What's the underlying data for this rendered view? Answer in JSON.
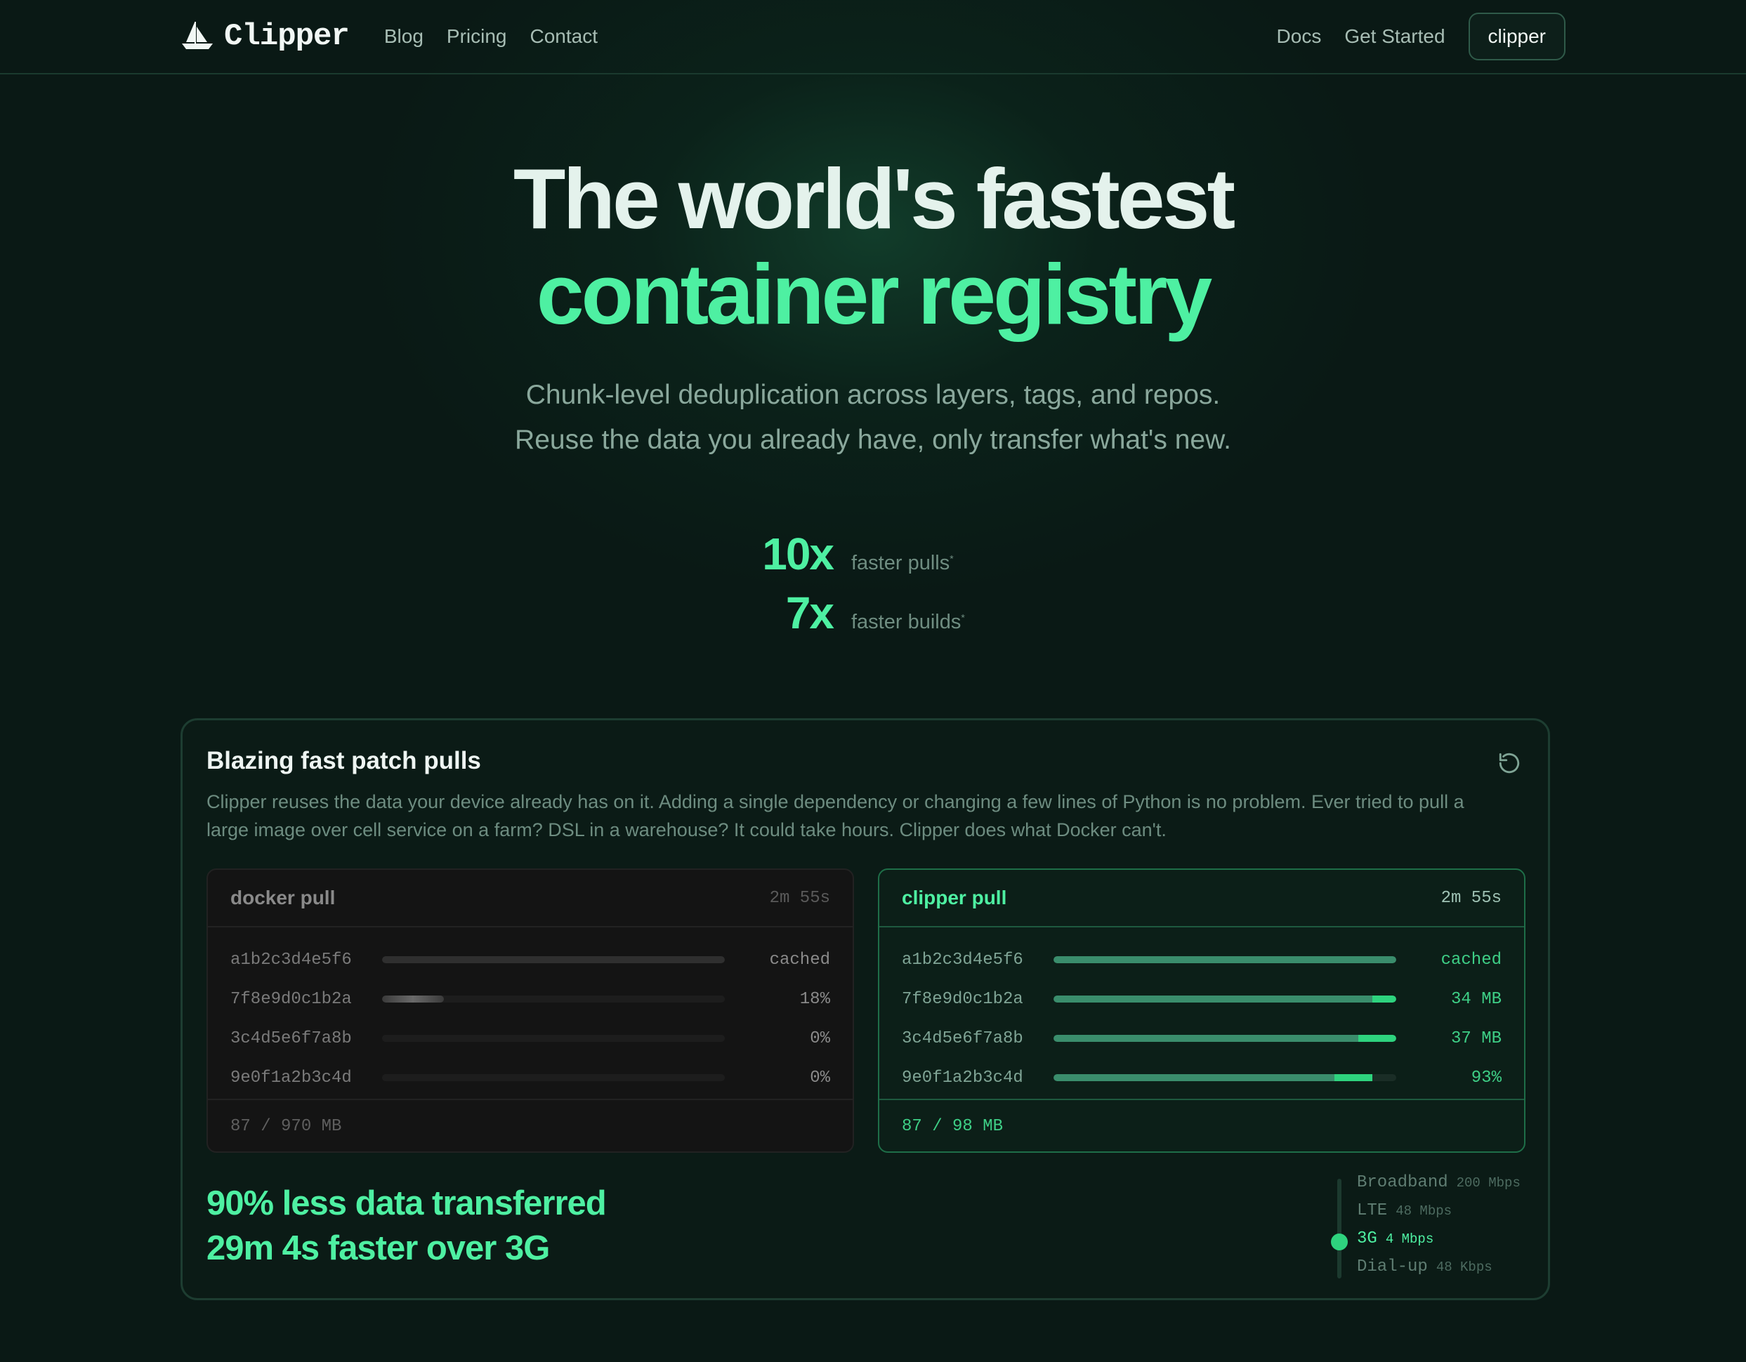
{
  "nav": {
    "brand": "Clipper",
    "links": [
      "Blog",
      "Pricing",
      "Contact"
    ],
    "right_links": [
      "Docs",
      "Get Started"
    ],
    "button_label": "clipper"
  },
  "hero": {
    "title_line1": "The world's fastest",
    "title_line2": "container registry",
    "subtitle_line1": "Chunk-level deduplication across layers, tags, and repos.",
    "subtitle_line2": "Reuse the data you already have, only transfer what's new."
  },
  "stats": [
    {
      "value": "10x",
      "label": "faster pulls",
      "mark": "*"
    },
    {
      "value": "7x",
      "label": "faster builds",
      "mark": "*"
    }
  ],
  "card": {
    "title": "Blazing fast patch pulls",
    "description": "Clipper reuses the data your device already has on it. Adding a single dependency or changing a few lines of Python is no problem. Ever tried to pull a large image over cell service on a farm? DSL in a warehouse? It could take hours. Clipper does what Docker can't.",
    "refresh_icon": "refresh-icon",
    "docker": {
      "name": "docker pull",
      "time": "2m 55s",
      "rows": [
        {
          "hash": "a1b2c3d4e5f6",
          "value": "cached",
          "progress": 1.0
        },
        {
          "hash": "7f8e9d0c1b2a",
          "value": "18%",
          "progress": 0.18
        },
        {
          "hash": "3c4d5e6f7a8b",
          "value": "0%",
          "progress": 0
        },
        {
          "hash": "9e0f1a2b3c4d",
          "value": "0%",
          "progress": 0
        }
      ],
      "footer": "87 / 970 MB"
    },
    "clipper": {
      "name": "clipper pull",
      "time": "2m 55s",
      "rows": [
        {
          "hash": "a1b2c3d4e5f6",
          "value": "cached",
          "reused": 1.0,
          "new": 0
        },
        {
          "hash": "7f8e9d0c1b2a",
          "value": "34 MB",
          "reused": 0.93,
          "new": 0.07
        },
        {
          "hash": "3c4d5e6f7a8b",
          "value": "37 MB",
          "reused": 0.89,
          "new": 0.11
        },
        {
          "hash": "9e0f1a2b3c4d",
          "value": "93%",
          "reused": 0.82,
          "new": 0.11
        }
      ],
      "footer": "87 / 98 MB"
    },
    "result_line1": "90% less data transferred",
    "result_line2": "29m 4s faster over 3G",
    "speeds": [
      {
        "name": "Broadband",
        "rate": "200 Mbps"
      },
      {
        "name": "LTE",
        "rate": "48 Mbps"
      },
      {
        "name": "3G",
        "rate": "4 Mbps",
        "active": true
      },
      {
        "name": "Dial-up",
        "rate": "48 Kbps"
      }
    ]
  },
  "colors": {
    "accent": "#4ef0a2",
    "background": "#0a1915",
    "progress_new": "#2ed37e",
    "progress_reused": "#3a8d6c"
  }
}
